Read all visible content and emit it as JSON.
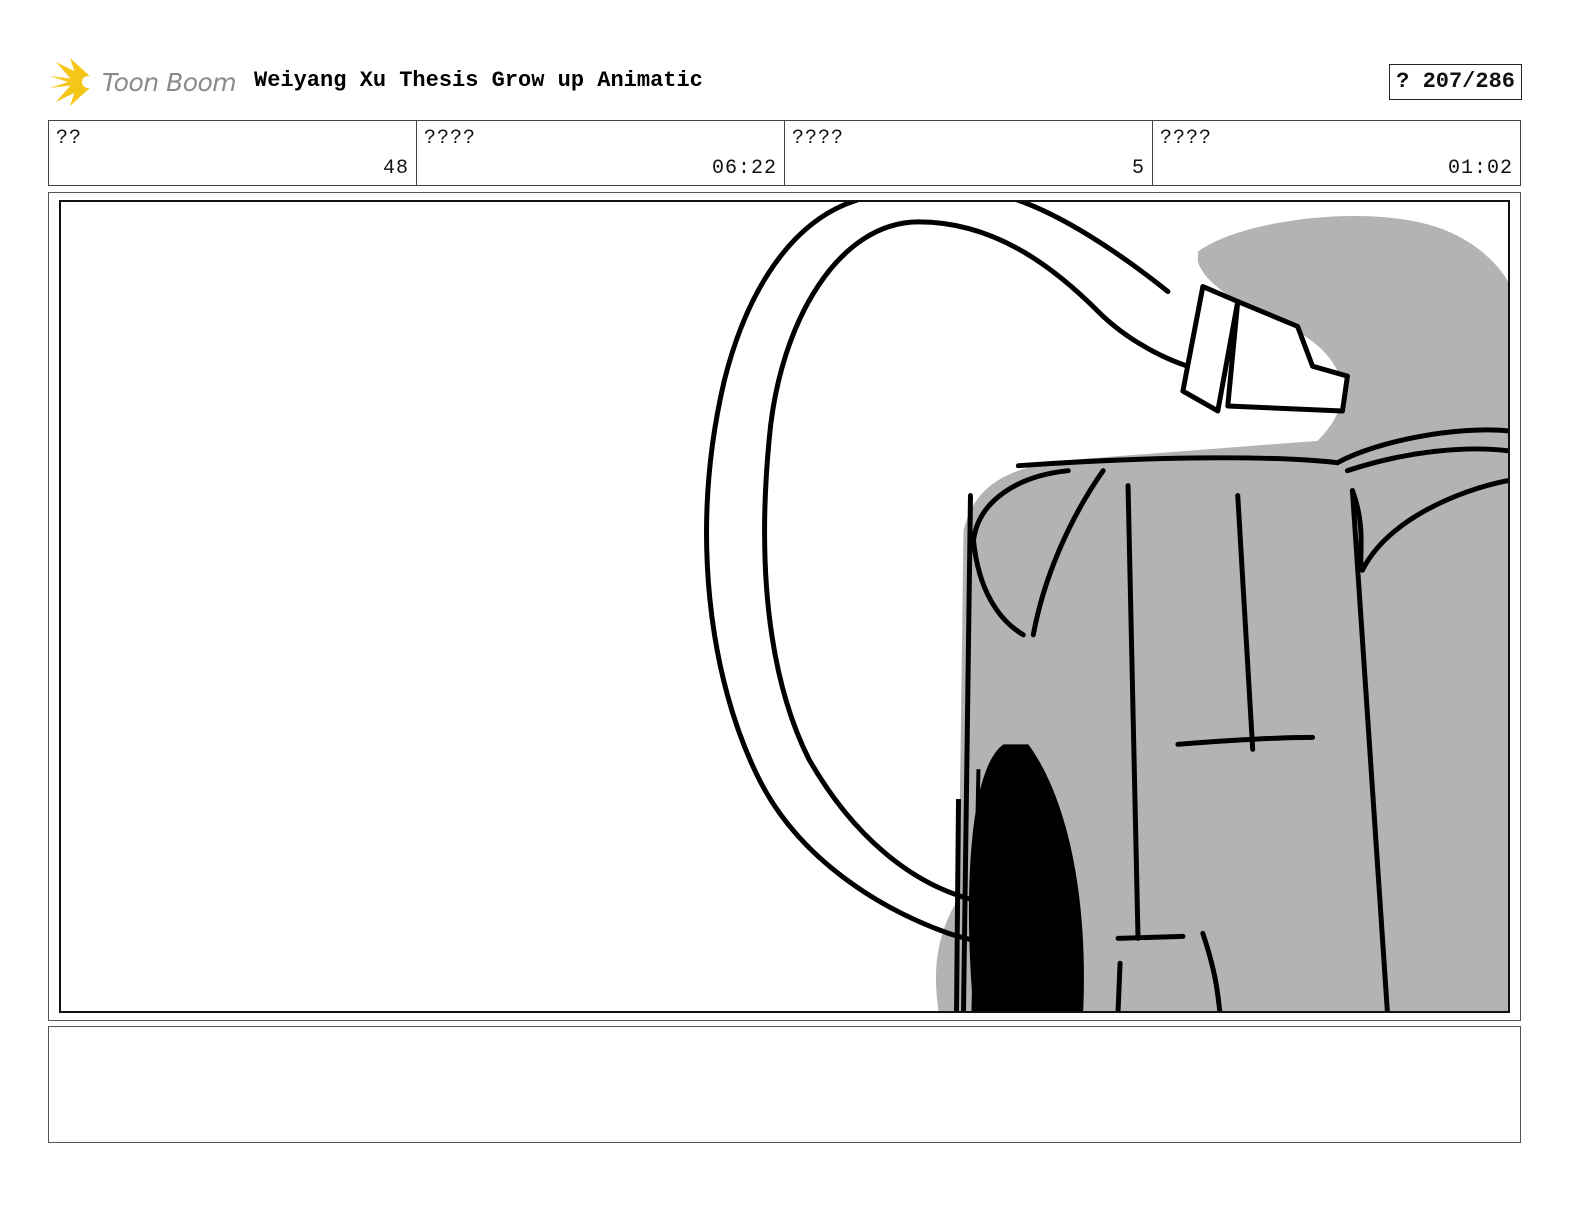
{
  "header": {
    "logo_text": "Toon Boom",
    "title": "Weiyang Xu Thesis Grow up Animatic",
    "page_counter": "? 207/286"
  },
  "info": [
    {
      "label": "??",
      "value": "48"
    },
    {
      "label": "????",
      "value": "06:22"
    },
    {
      "label": "????",
      "value": "5"
    },
    {
      "label": "????",
      "value": "01:02"
    }
  ],
  "notes": {
    "text": ""
  },
  "colors": {
    "logo_yellow": "#f5c518",
    "logo_text": "#8a8a8a",
    "tone_gray": "#b3b3b3"
  }
}
